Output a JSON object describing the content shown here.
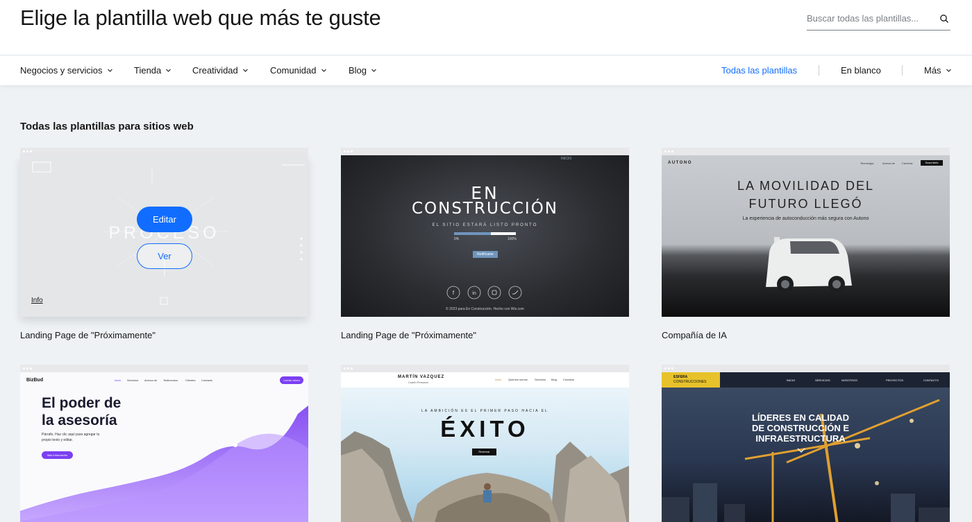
{
  "header": {
    "title": "Elige la plantilla web que más te guste",
    "search_placeholder": "Buscar todas las plantillas...",
    "search_icon": "search-icon"
  },
  "nav": {
    "categories": [
      {
        "label": "Negocios y servicios"
      },
      {
        "label": "Tienda"
      },
      {
        "label": "Creatividad"
      },
      {
        "label": "Comunidad"
      },
      {
        "label": "Blog"
      }
    ],
    "all_templates": "Todas las plantillas",
    "blank": "En blanco",
    "more": "Más",
    "active_color": "#116dff"
  },
  "section": {
    "title": "Todas las plantillas para sitios web"
  },
  "cards": [
    {
      "label": "Landing Page de \"Próximamente\"",
      "edit": "Editar",
      "view": "Ver",
      "info": "Info",
      "bg_word": "PROCESO"
    },
    {
      "label": "Landing Page de \"Próximamente\"",
      "nav_link": "INICIO",
      "heading1": "EN",
      "heading2": "CONSTRUCCIÓN",
      "subheading": "EL SITIO ESTARÁ LISTO PRONTO",
      "progress_start": "0%",
      "progress_end": "100%",
      "progress_fraction": 0.6,
      "button": "Notifícame",
      "footer": "© 2023 para En Construcción. Hecho con Wix.com"
    },
    {
      "label": "Compañía de IA",
      "brand": "AUTONO",
      "menu": [
        "Tecnología",
        "Acerca de",
        "Carreras"
      ],
      "cta": "Suscríbete",
      "heading1": "LA MOVILIDAD DEL",
      "heading2": "FUTURO LLEGÓ",
      "subheading": "La experiencia de autoconducción más segura con Autono"
    },
    {
      "brand": "BizBud",
      "menu": [
        "Inicio",
        "Servicios",
        "Acerca de",
        "Testimonios",
        "Clientes",
        "Contacto"
      ],
      "cta": "Llamar ahora",
      "heading1": "El poder de",
      "heading2": "la asesoría",
      "paragraph1": "Párrafo. Haz clic aquí para agregar tu",
      "paragraph2": "propio texto y editar.",
      "button": "Más información",
      "accent": "#7b3ff2"
    },
    {
      "brand": "MARTÍN VAZQUEZ",
      "tagline": "Coach Personal",
      "menu": [
        "Inicio",
        "Quienes somos",
        "Servicios",
        "Blog",
        "Contacto"
      ],
      "kicker": "LA AMBICIÓN ES EL PRIMER PASO HACIA EL",
      "heading": "ÉXITO",
      "button": "Reservar"
    },
    {
      "brand1": "ESFERA",
      "brand2": "CONSTRUCCIONES",
      "menu": [
        "INICIO",
        "SERVICIOS",
        "NOSOTROS",
        "PROYECTOS",
        "CONTACTO"
      ],
      "heading1": "LÍDERES EN CALIDAD",
      "heading2": "DE CONSTRUCCIÓN E",
      "heading3": "INFRAESTRUCTURA",
      "accent": "#e8c22a"
    }
  ]
}
